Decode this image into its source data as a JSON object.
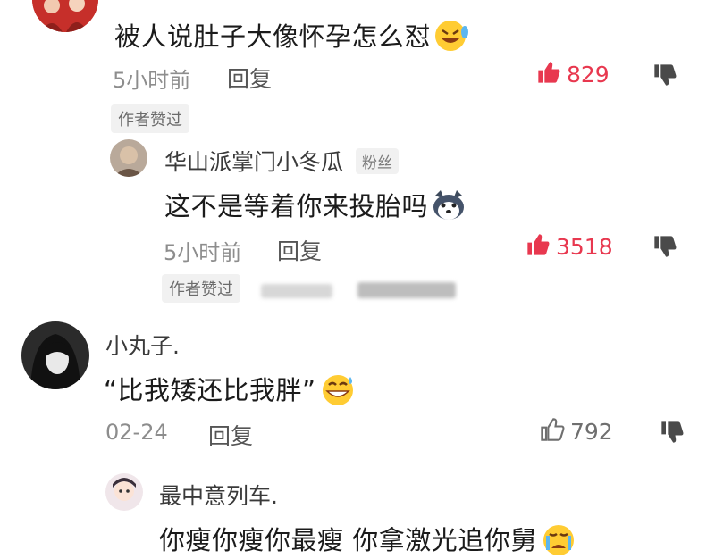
{
  "comments": [
    {
      "text": "被人说肚子大像怀孕怎么怼",
      "emoji": "rofl-emoji",
      "time": "5小时前",
      "reply_label": "回复",
      "likes": "829",
      "liked": true,
      "author_liked_tag": "作者赞过",
      "replies": [
        {
          "nickname": "华山派掌门小冬瓜",
          "badge": "粉丝",
          "text": "这不是等着你来投胎吗",
          "emoji": "husky-emoji",
          "time": "5小时前",
          "reply_label": "回复",
          "likes": "3518",
          "liked": true,
          "author_liked_tag": "作者赞过"
        }
      ]
    },
    {
      "nickname": "小丸子.",
      "text": "“比我矮还比我胖”",
      "emoji": "grin-sweat-emoji",
      "time": "02-24",
      "reply_label": "回复",
      "likes": "792",
      "liked": false,
      "replies": [
        {
          "nickname": "最中意列车.",
          "text": "你瘦你瘦你最瘦 你拿激光追你舅",
          "emoji": "crying-emoji"
        }
      ]
    }
  ],
  "colors": {
    "like_red": "#e8384f",
    "text_gray": "#8d8d8d"
  }
}
